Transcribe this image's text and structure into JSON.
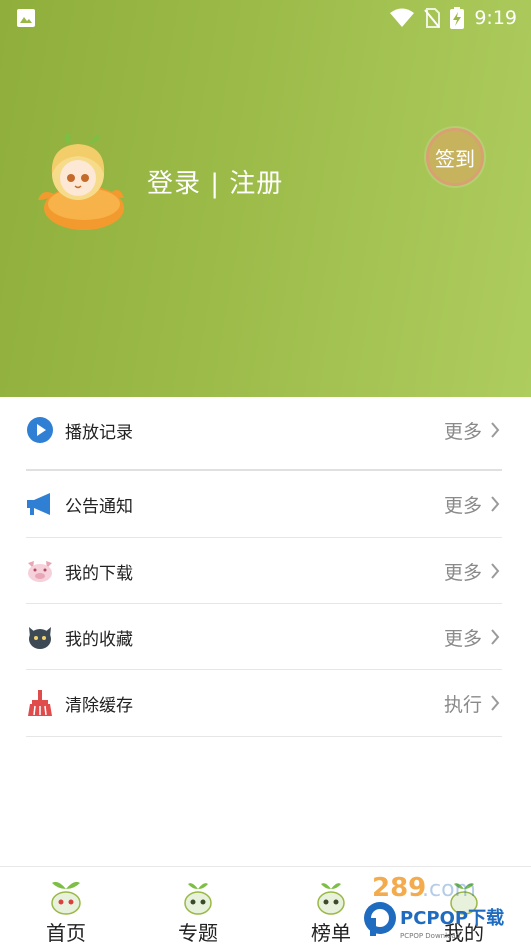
{
  "status_bar": {
    "time": "9:19"
  },
  "header": {
    "login_text": "登录 | 注册",
    "signin_label": "签到"
  },
  "menu": [
    {
      "label": "播放记录",
      "action": "更多",
      "icon": "play-icon",
      "color": "#2f7fd4"
    },
    {
      "label": "公告通知",
      "action": "更多",
      "icon": "megaphone-icon",
      "color": "#2f7fd4"
    },
    {
      "label": "我的下载",
      "action": "更多",
      "icon": "pig-icon",
      "color": "#e8a6b6"
    },
    {
      "label": "我的收藏",
      "action": "更多",
      "icon": "cat-icon",
      "color": "#3d4a55"
    },
    {
      "label": "清除缓存",
      "action": "执行",
      "icon": "broom-icon",
      "color": "#e04b4b"
    }
  ],
  "tabs": [
    {
      "label": "首页"
    },
    {
      "label": "专题"
    },
    {
      "label": "榜单"
    },
    {
      "label": "我的"
    }
  ],
  "watermark": {
    "text": "PCPOP下载",
    "sub": "PCPOP Download"
  },
  "colors": {
    "header_start": "#8fae3c",
    "header_end": "#aecd5f",
    "accent_blue": "#2f7fd4"
  }
}
